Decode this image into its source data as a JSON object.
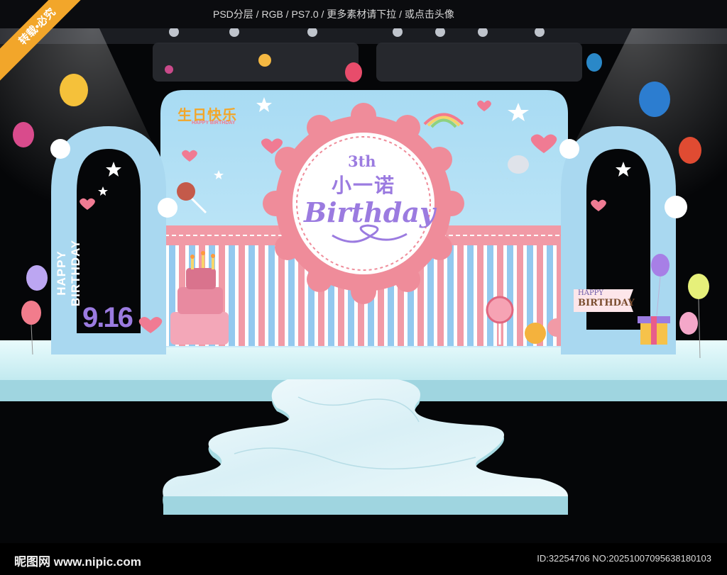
{
  "header": {
    "info": "PSD分层 / RGB / PS7.0 / 更多素材请下拉 / 或点击头像"
  },
  "watermark": {
    "corner_label": "转载•必究"
  },
  "footer": {
    "logo": "昵图网 www.nipic.com",
    "id_text": "ID:32254706 NO:20251007095638180103"
  },
  "backdrop": {
    "logo_title": "生日快乐",
    "logo_small": "HAPPY BIRTHDAY",
    "age": "3th",
    "name": "小一诺",
    "script": "Birthday"
  },
  "left_arch": {
    "vertical_text": "HAPPY BIRTHDAY",
    "date": "9.16"
  },
  "right_arch": {
    "banner_line1": "HAPPY",
    "banner_line2": "BIRTHDAY"
  },
  "colors": {
    "sky_blue": "#a9d8f0",
    "pink": "#ef8c9a",
    "lavender": "#9b7be0",
    "floor": "#c7eef2"
  }
}
